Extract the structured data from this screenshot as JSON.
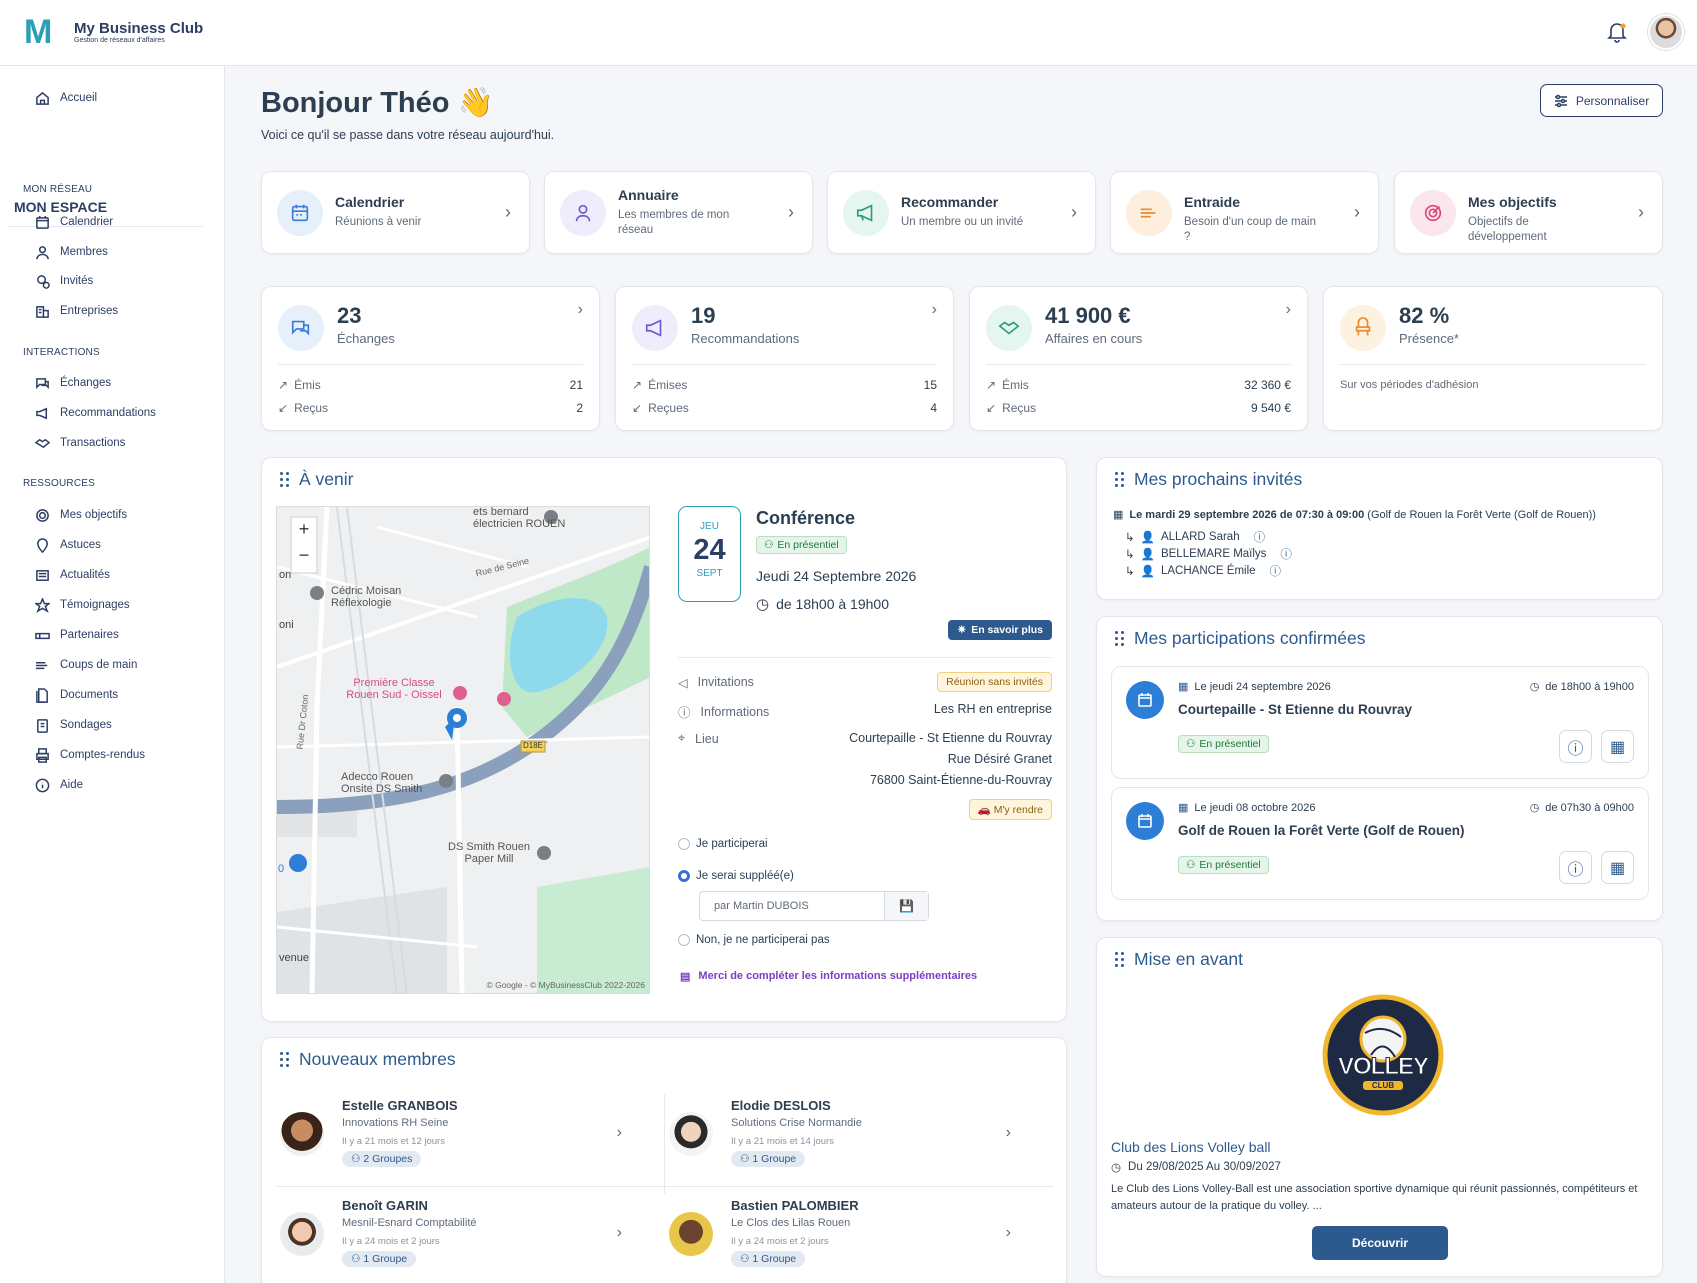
{
  "brand": {
    "name": "My Business Club",
    "tagline": "Gestion de réseaux d'affaires",
    "logo_letter": "M"
  },
  "sidebar": {
    "home": "Accueil",
    "title": "MON ESPACE",
    "sections": [
      {
        "label": "MON RÉSEAU",
        "items": [
          "Calendrier",
          "Membres",
          "Invités",
          "Entreprises"
        ]
      },
      {
        "label": "INTERACTIONS",
        "items": [
          "Échanges",
          "Recommandations",
          "Transactions"
        ]
      },
      {
        "label": "RESSOURCES",
        "items": [
          "Mes objectifs",
          "Astuces",
          "Actualités",
          "Témoignages",
          "Partenaires",
          "Coups de main",
          "Documents",
          "Sondages",
          "Comptes-rendus",
          "Aide"
        ]
      }
    ]
  },
  "header": {
    "greeting": "Bonjour Théo 👋",
    "subtitle": "Voici ce qu'il se passe dans votre réseau aujourd'hui.",
    "customize": "Personnaliser"
  },
  "quick": [
    {
      "title": "Calendrier",
      "sub": "Réunions à venir",
      "icon": "calendar-icon",
      "color": "#3b7bd8",
      "bg": "#e6f0fb"
    },
    {
      "title": "Annuaire",
      "sub": "Les membres de mon réseau",
      "icon": "member-icon",
      "color": "#6a5acd",
      "bg": "#efedfb"
    },
    {
      "title": "Recommander",
      "sub": "Un membre ou un invité",
      "icon": "megaphone-icon",
      "color": "#2a9d7a",
      "bg": "#e5f6f0"
    },
    {
      "title": "Entraide",
      "sub": "Besoin d'un coup de main ?",
      "icon": "handshake-icon",
      "color": "#e88a2f",
      "bg": "#fdeedd"
    },
    {
      "title": "Mes objectifs",
      "sub": "Objectifs de développement",
      "icon": "target-icon",
      "color": "#d8457a",
      "bg": "#fbe6ee"
    }
  ],
  "stats": [
    {
      "num": "23",
      "label": "Échanges",
      "l1": "Émis",
      "v1": "21",
      "l2": "Reçus",
      "v2": "2",
      "color": "#3b7bd8",
      "bg": "#e6f0fb"
    },
    {
      "num": "19",
      "label": "Recommandations",
      "l1": "Émises",
      "v1": "15",
      "l2": "Reçues",
      "v2": "4",
      "color": "#6a5acd",
      "bg": "#efedfb"
    },
    {
      "num": "41 900 €",
      "label": "Affaires en cours",
      "l1": "Émis",
      "v1": "32 360 €",
      "l2": "Reçus",
      "v2": "9 540 €",
      "color": "#2a9d7a",
      "bg": "#e5f6f0"
    },
    {
      "num": "82 %",
      "label": "Présence*",
      "note": "Sur vos périodes d'adhésion",
      "color": "#e88a2f",
      "bg": "#fdf1e0"
    }
  ],
  "upcoming": {
    "title": "À venir",
    "cal": {
      "month": "JEU",
      "day": "24",
      "sub": "SEPT"
    },
    "event_title": "Conférence",
    "mode": "En présentiel",
    "date": "Jeudi 24 Septembre 2026",
    "time": "de 18h00 à 19h00",
    "more": "En savoir plus",
    "invitations_label": "Invitations",
    "invitations_value": "Réunion sans invités",
    "informations_label": "Informations",
    "informations_value": "Les RH en entreprise",
    "lieu_label": "Lieu",
    "lieu_lines": [
      "Courtepaille - St Etienne du Rouvray",
      "Rue Désiré Granet",
      "76800 Saint-Étienne-du-Rouvray"
    ],
    "directions": "M'y rendre",
    "r1": "Je participerai",
    "r2": "Je serai suppléé(e)",
    "substitute": "par Martin DUBOIS",
    "r3": "Non, je ne participerai pas",
    "complete": "Merci de compléter les informations supplémentaires",
    "map": {
      "labels": [
        "ets bernard électricien ROUEN",
        "Cédric Moisan Réflexologie",
        "Première Classe Rouen Sud - Oissel",
        "Adecco Rouen Onsite DS Smith",
        "DS Smith Rouen Paper Mill",
        "Rue de Seine",
        "Rue Dr Coton",
        "D18E",
        "on",
        "oni",
        "venue",
        "0"
      ],
      "credit": "© Google - © MyBusinessClub 2022-2026"
    }
  },
  "guests": {
    "title": "Mes prochains invités",
    "date_bold": "Le mardi 29 septembre 2026 de 07:30 à 09:00",
    "date_rest": " (Golf de Rouen la Forêt Verte (Golf de Rouen))",
    "names": [
      "ALLARD Sarah",
      "BELLEMARE Maïlys",
      "LACHANCE Émile"
    ]
  },
  "participations": {
    "title": "Mes participations confirmées",
    "items": [
      {
        "date": "Le jeudi 24 septembre 2026",
        "time": "de 18h00 à 19h00",
        "name": "Courtepaille - St Etienne du Rouvray",
        "mode": "En présentiel"
      },
      {
        "date": "Le jeudi 08 octobre 2026",
        "time": "de 07h30 à 09h00",
        "name": "Golf de Rouen la Forêt Verte (Golf de Rouen)",
        "mode": "En présentiel"
      }
    ]
  },
  "featured": {
    "title": "Mise en avant",
    "logo_text": "VOLLEY",
    "logo_sub": "CLUB",
    "name": "Club des Lions Volley ball",
    "dates": "Du 29/08/2025 Au 30/09/2027",
    "desc": "Le Club des Lions Volley-Ball est une association sportive dynamique qui réunit passionnés, compétiteurs et amateurs autour de la pratique du volley. ...",
    "cta": "Découvrir"
  },
  "members": {
    "title": "Nouveaux membres",
    "items": [
      {
        "name": "Estelle GRANBOIS",
        "company": "Innovations RH Seine",
        "since": "Il y a 21 mois et 12 jours",
        "groups": "2 Groupes"
      },
      {
        "name": "Elodie DESLOIS",
        "company": "Solutions Crise Normandie",
        "since": "Il y a 21 mois et 14 jours",
        "groups": "1 Groupe"
      },
      {
        "name": "Benoît GARIN",
        "company": "Mesnil-Esnard Comptabilité",
        "since": "Il y a 24 mois et 2 jours",
        "groups": "1 Groupe"
      },
      {
        "name": "Bastien PALOMBIER",
        "company": "Le Clos des Lilas Rouen",
        "since": "Il y a 24 mois et 2 jours",
        "groups": "1 Groupe"
      }
    ]
  }
}
